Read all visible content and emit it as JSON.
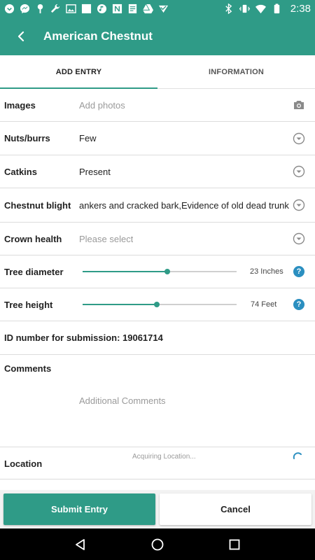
{
  "status_bar": {
    "time": "2:38",
    "left_icons": [
      "app-icon",
      "messenger-icon",
      "tree-icon",
      "wrench-icon",
      "image-icon",
      "square-icon",
      "music-icon",
      "notion-icon",
      "document-icon",
      "drive-icon",
      "check-icon"
    ],
    "right_icons": [
      "bluetooth-icon",
      "vibrate-icon",
      "wifi-icon",
      "battery-icon"
    ]
  },
  "app_bar": {
    "title": "American Chestnut",
    "back_icon": "back-arrow-icon",
    "color": "#2f9b87"
  },
  "tabs": [
    {
      "label": "ADD ENTRY",
      "active": true
    },
    {
      "label": "INFORMATION",
      "active": false
    }
  ],
  "form": {
    "images": {
      "label": "Images",
      "placeholder": "Add photos",
      "icon": "camera-icon"
    },
    "nuts_burrs": {
      "label": "Nuts/burrs",
      "value": "Few",
      "icon": "dropdown-icon"
    },
    "catkins": {
      "label": "Catkins",
      "value": "Present",
      "icon": "dropdown-icon"
    },
    "chestnut_blight": {
      "label": "Chestnut blight",
      "value": "ankers and cracked bark,Evidence of old dead trunk",
      "icon": "dropdown-icon"
    },
    "crown_health": {
      "label": "Crown health",
      "placeholder": "Please select",
      "icon": "dropdown-icon"
    },
    "tree_diameter": {
      "label": "Tree diameter",
      "value_text": "23 Inches",
      "slider_fraction": 0.55,
      "help": "?"
    },
    "tree_height": {
      "label": "Tree height",
      "value_text": "74 Feet",
      "slider_fraction": 0.48,
      "help": "?"
    },
    "id_number": {
      "label": "ID number for submission: 19061714"
    },
    "comments": {
      "label": "Comments",
      "placeholder": "Additional Comments"
    },
    "location": {
      "label": "Location",
      "status": "Acquiring Location..."
    }
  },
  "buttons": {
    "submit": "Submit Entry",
    "cancel": "Cancel"
  },
  "nav_bar": [
    "back-nav-icon",
    "home-nav-icon",
    "recents-nav-icon"
  ]
}
